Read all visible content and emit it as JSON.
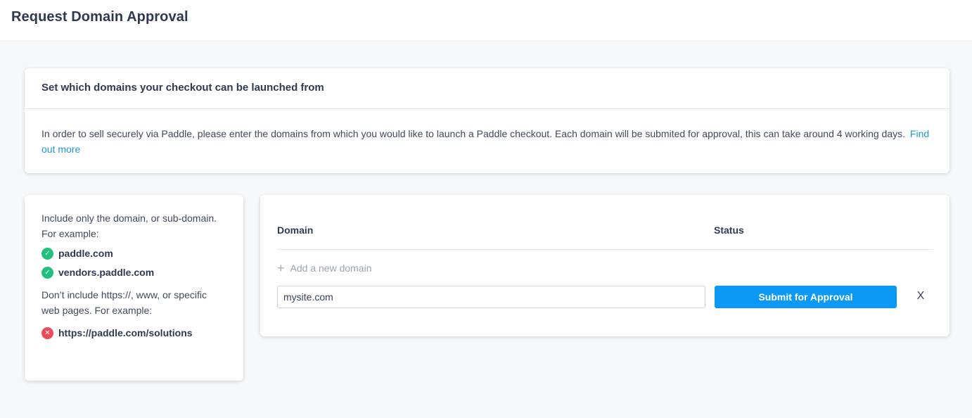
{
  "page": {
    "title": "Request Domain Approval"
  },
  "intro": {
    "heading": "Set which domains your checkout can be launched from",
    "body": "In order to sell securely via Paddle, please enter the domains from which you would like to launch a Paddle checkout. Each domain will be submited for approval, this can take around 4 working days.",
    "link": "Find out more"
  },
  "help": {
    "include_text": "Include only the domain, or sub-domain. For example:",
    "good_examples": [
      "paddle.com",
      "vendors.paddle.com"
    ],
    "exclude_text": "Don’t include https://, www, or specific web pages. For example:",
    "bad_example": "https://paddle.com/solutions",
    "icons": {
      "good": "check-icon",
      "bad": "cross-icon"
    },
    "colors": {
      "good": "#21c07e",
      "bad": "#ef4a57"
    }
  },
  "table": {
    "columns": {
      "domain": "Domain",
      "status": "Status"
    },
    "add_label": "Add a new domain",
    "input_value": "mysite.com",
    "submit_label": "Submit for Approval",
    "close_label": "X"
  },
  "colors": {
    "accent": "#0b99f5",
    "link": "#1a9bd6"
  }
}
